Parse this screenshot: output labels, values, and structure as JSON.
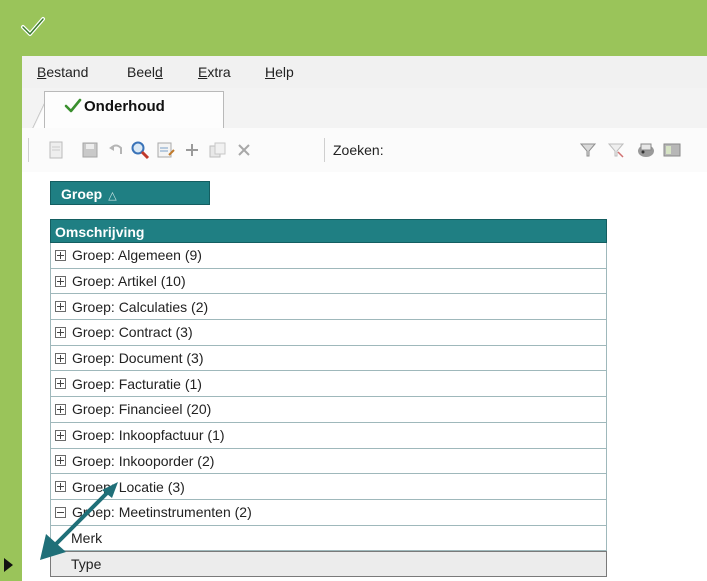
{
  "menu": [
    {
      "label": "Bestand",
      "key": "B"
    },
    {
      "label": "Beeld",
      "key": "d"
    },
    {
      "label": "Extra",
      "key": "E"
    },
    {
      "label": "Help",
      "key": "H"
    }
  ],
  "tab": {
    "label": "Onderhoud"
  },
  "toolbar": {
    "search_label": "Zoeken:"
  },
  "grid": {
    "group_header": "Groep",
    "column_header": "Omschrijving",
    "groups": [
      {
        "label": "Groep: Algemeen (9)",
        "expanded": false
      },
      {
        "label": "Groep: Artikel (10)",
        "expanded": false
      },
      {
        "label": "Groep: Calculaties (2)",
        "expanded": false
      },
      {
        "label": "Groep: Contract (3)",
        "expanded": false
      },
      {
        "label": "Groep: Document (3)",
        "expanded": false
      },
      {
        "label": "Groep: Facturatie (1)",
        "expanded": false
      },
      {
        "label": "Groep: Financieel (20)",
        "expanded": false
      },
      {
        "label": "Groep: Inkoopfactuur (1)",
        "expanded": false
      },
      {
        "label": "Groep: Inkooporder (2)",
        "expanded": false
      },
      {
        "label": "Groep: Locatie (3)",
        "expanded": false
      },
      {
        "label": "Groep: Meetinstrumenten (2)",
        "expanded": true
      }
    ],
    "children": [
      "Merk",
      "Type"
    ]
  },
  "colors": {
    "accent": "#9ac45a",
    "header": "#1f7f83",
    "arrow": "#1f6f78"
  }
}
